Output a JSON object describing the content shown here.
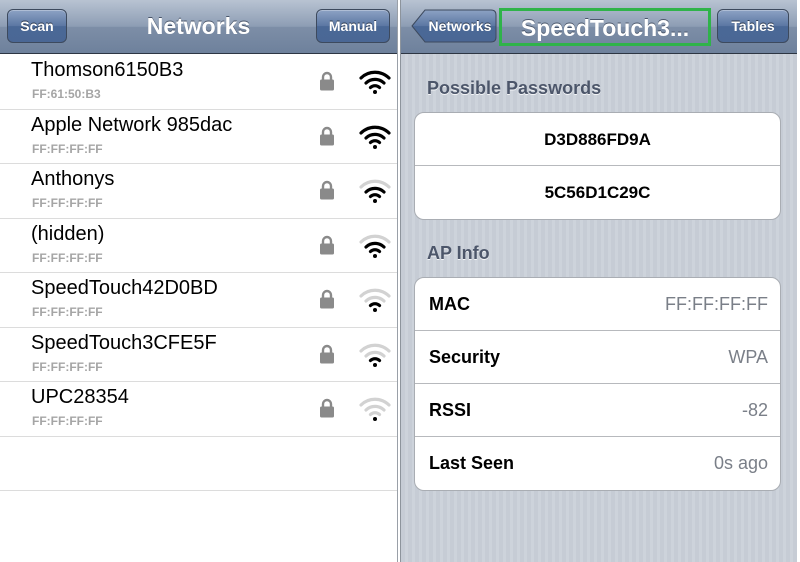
{
  "left": {
    "title": "Networks",
    "scan_label": "Scan",
    "manual_label": "Manual",
    "networks": [
      {
        "name": "Thomson6150B3",
        "mac": "FF:61:50:B3",
        "locked": true,
        "signal_bars": 3
      },
      {
        "name": "Apple Network 985dac",
        "mac": "FF:FF:FF:FF",
        "locked": true,
        "signal_bars": 3
      },
      {
        "name": "Anthonys",
        "mac": "FF:FF:FF:FF",
        "locked": true,
        "signal_bars": 2
      },
      {
        "name": "(hidden)",
        "mac": "FF:FF:FF:FF",
        "locked": true,
        "signal_bars": 2
      },
      {
        "name": "SpeedTouch42D0BD",
        "mac": "FF:FF:FF:FF",
        "locked": true,
        "signal_bars": 1
      },
      {
        "name": "SpeedTouch3CFE5F",
        "mac": "FF:FF:FF:FF",
        "locked": true,
        "signal_bars": 1
      },
      {
        "name": "UPC28354",
        "mac": "FF:FF:FF:FF",
        "locked": true,
        "signal_bars": 0
      }
    ]
  },
  "right": {
    "back_label": "Networks",
    "title": "SpeedTouch3...",
    "tables_label": "Tables",
    "highlight_color": "#2fb34a",
    "passwords_title": "Possible Passwords",
    "passwords": [
      "D3D886FD9A",
      "5C56D1C29C"
    ],
    "ap_info_title": "AP Info",
    "ap_info": [
      {
        "key": "MAC",
        "value": "FF:FF:FF:FF"
      },
      {
        "key": "Security",
        "value": "WPA"
      },
      {
        "key": "RSSI",
        "value": "-82"
      },
      {
        "key": "Last Seen",
        "value": "0s ago"
      }
    ]
  }
}
